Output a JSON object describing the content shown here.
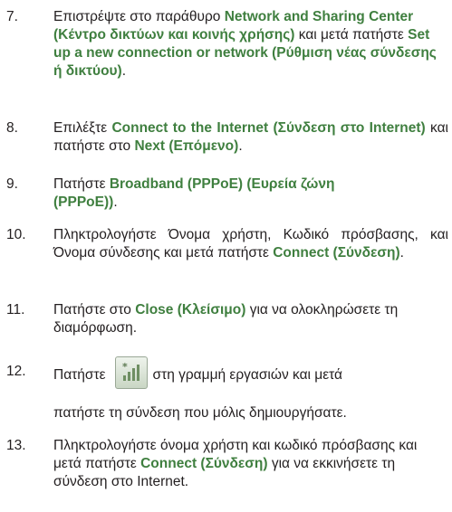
{
  "steps": [
    {
      "num": "7.",
      "parts": [
        {
          "t": "Επιστρέψτε στο παράθυρο ",
          "b": false
        },
        {
          "t": "Network and Sharing Center (Κέντρο δικτύων και κοινής χρήσης)",
          "b": true
        },
        {
          "t": " και μετά πατήστε ",
          "b": false
        },
        {
          "t": "Set up a new connection or network (Ρύθμιση νέας σύνδεσης ή δικτύου)",
          "b": true
        },
        {
          "t": ".",
          "b": false
        }
      ]
    },
    {
      "num": "8.",
      "parts": [
        {
          "t": "Επιλέξτε ",
          "b": false
        },
        {
          "t": "Connect to the Internet (Σύνδεση στο Internet)",
          "b": true
        },
        {
          "t": " και πατήστε στο ",
          "b": false
        },
        {
          "t": "Next (Επόμενο)",
          "b": true
        },
        {
          "t": ".",
          "b": false
        }
      ]
    },
    {
      "num": "9.",
      "parts": [
        {
          "t": "Πατήστε ",
          "b": false
        },
        {
          "t": "Broadband (PPPoE) (Ευρεία ζώνη (PPPoE))",
          "b": true
        },
        {
          "t": ".",
          "b": false
        }
      ]
    },
    {
      "num": "10.",
      "parts": [
        {
          "t": "Πληκτρολογήστε Όνομα χρήστη, Κωδικό πρόσβασης, και Όνομα σύνδεσης και μετά πατήστε ",
          "b": false
        },
        {
          "t": "Connect (Σύνδεση)",
          "b": true
        },
        {
          "t": ".",
          "b": false
        }
      ]
    },
    {
      "num": "11.",
      "parts": [
        {
          "t": "Πατήστε στο ",
          "b": false
        },
        {
          "t": "Close (Κλείσιμο)",
          "b": true
        },
        {
          "t": " για να ολοκληρώσετε τη διαμόρφωση.",
          "b": false
        }
      ]
    },
    {
      "num": "12.",
      "before": "Πατήστε",
      "after": "στη γραμμή εργασιών και μετά",
      "line2": "πατήστε τη σύνδεση που μόλις δημιουργήσατε.",
      "icon": "network-connection-icon"
    },
    {
      "num": "13.",
      "parts": [
        {
          "t": "Πληκτρολογήστε όνομα χρήστη και κωδικό πρόσβασης και μετά πατήστε ",
          "b": false
        },
        {
          "t": "Connect (Σύνδεση)",
          "b": true
        },
        {
          "t": " για να εκκινήσετε τη σύνδεση στο Internet.",
          "b": false
        }
      ]
    }
  ],
  "colors": {
    "text": "#231f20",
    "highlight": "#3f7f3f"
  }
}
